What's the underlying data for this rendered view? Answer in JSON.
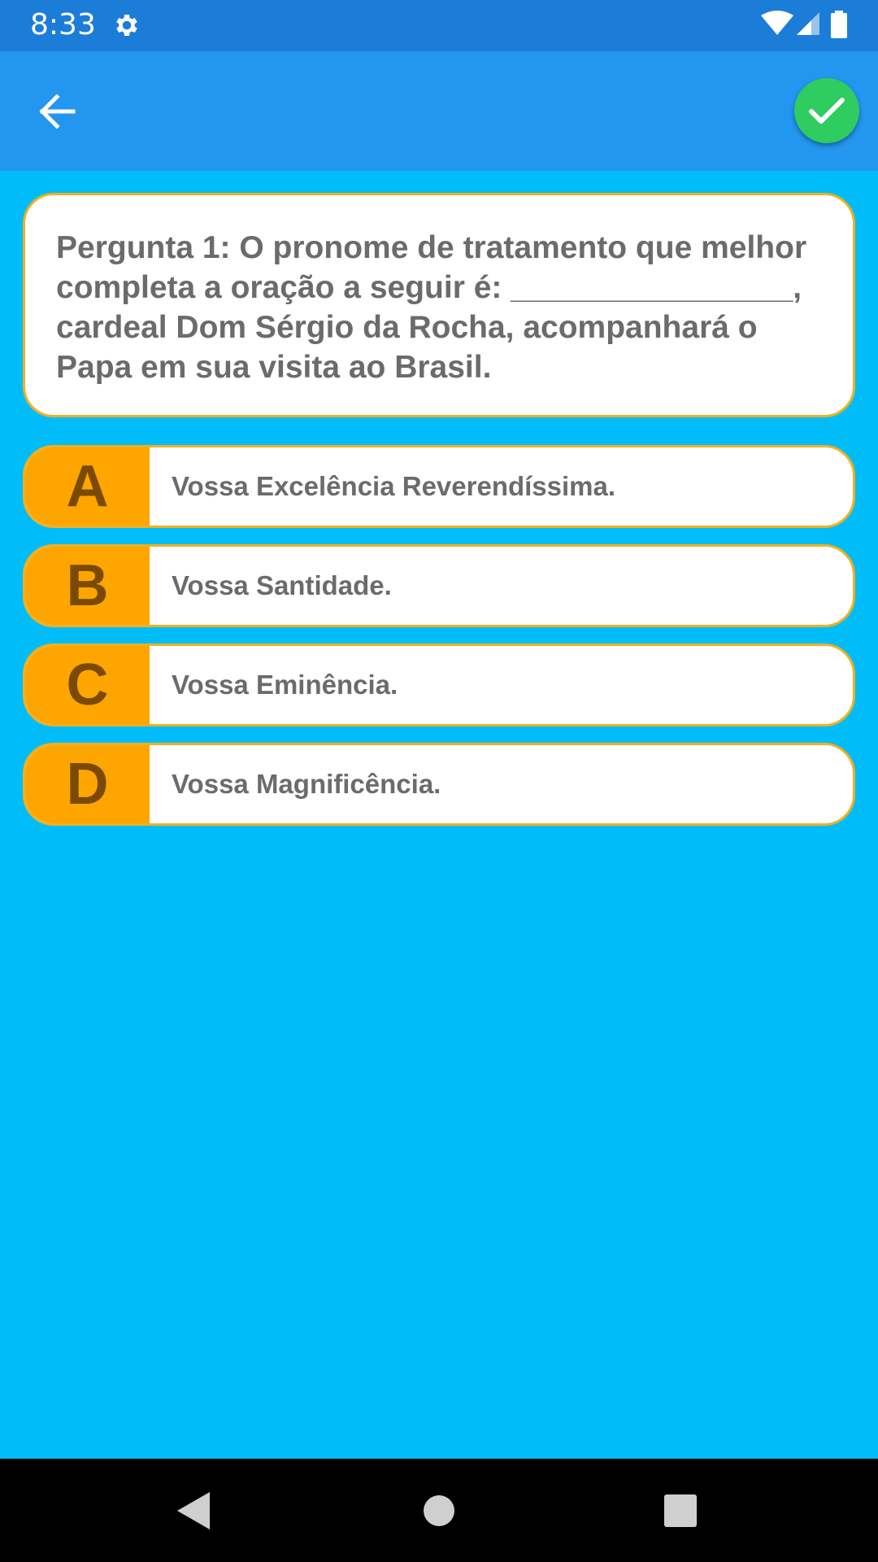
{
  "status_bar": {
    "time": "8:33",
    "icons": [
      "gear-icon",
      "wifi-icon",
      "cell-signal-icon",
      "battery-icon"
    ]
  },
  "app_bar": {
    "back_icon": "arrow-left-icon",
    "confirm_icon": "check-icon",
    "confirm_color": "#2ECC61"
  },
  "question": {
    "text": "Pergunta 1: O pronome de tratamento que melhor completa a oração a seguir é: ________________, cardeal Dom Sérgio da Rocha, acompanhará o Papa em sua visita ao Brasil."
  },
  "options": [
    {
      "letter": "A",
      "text": "Vossa Excelência Reverendíssima."
    },
    {
      "letter": "B",
      "text": "Vossa Santidade."
    },
    {
      "letter": "C",
      "text": "Vossa Eminência."
    },
    {
      "letter": "D",
      "text": "Vossa Magnificência."
    }
  ],
  "colors": {
    "background": "#00BDFA",
    "status_bar": "#1C7DD9",
    "app_bar": "#2396F0",
    "option_letter_bg": "#FFA500",
    "card_border": "#F2B01E"
  },
  "nav_bar": {
    "icons": [
      "back-triangle-icon",
      "home-circle-icon",
      "recents-square-icon"
    ]
  }
}
